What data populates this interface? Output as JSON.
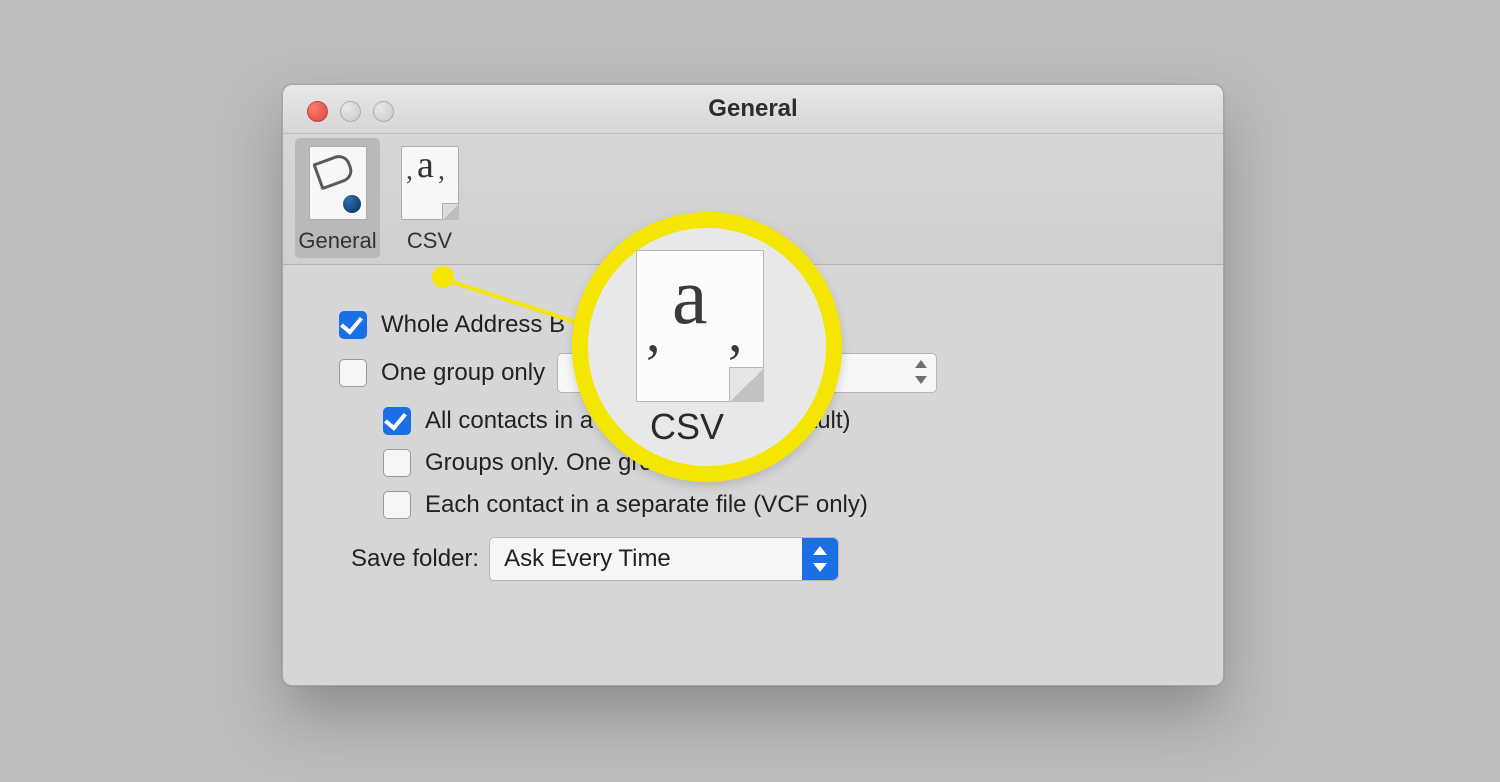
{
  "window": {
    "title": "General"
  },
  "tabs": {
    "general": "General",
    "csv": "CSV"
  },
  "options": {
    "whole_address_book": {
      "label": "Whole Address B",
      "checked": true
    },
    "one_group_only": {
      "label": "One group only",
      "checked": false
    },
    "all_single_file": {
      "label": "All contacts in a single file (CSV default)",
      "checked": true
    },
    "groups_only": {
      "label": "Groups only. One group per file",
      "checked": false
    },
    "each_separate": {
      "label": "Each contact in a separate file (VCF only)",
      "checked": false
    }
  },
  "save_folder": {
    "label": "Save folder:",
    "value": "Ask Every Time"
  },
  "callout": {
    "label": "CSV"
  }
}
